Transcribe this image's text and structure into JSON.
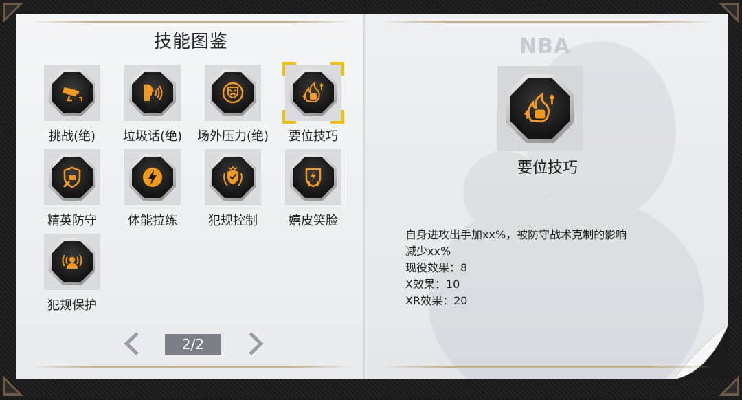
{
  "left_page": {
    "title": "技能图鉴",
    "skills": [
      {
        "label": "挑战(绝)",
        "icon": "camera-icon",
        "selected": false
      },
      {
        "label": "垃圾话(绝)",
        "icon": "trash-talk-icon",
        "selected": false
      },
      {
        "label": "场外压力(绝)",
        "icon": "pressure-mask-icon",
        "selected": false
      },
      {
        "label": "要位技巧",
        "icon": "flame-fist-icon",
        "selected": true
      },
      {
        "label": "精英防守",
        "icon": "shield-wrench-icon",
        "selected": false
      },
      {
        "label": "体能拉练",
        "icon": "lightning-icon",
        "selected": false
      },
      {
        "label": "犯规控制",
        "icon": "laurel-shield-icon",
        "selected": false
      },
      {
        "label": "嬉皮笑脸",
        "icon": "shield-down-icon",
        "selected": false
      },
      {
        "label": "犯规保护",
        "icon": "person-signal-icon",
        "selected": false
      }
    ],
    "pagination": {
      "current_label": "2/2"
    }
  },
  "right_page": {
    "brand": "NBA",
    "skill_name": "要位技巧",
    "skill_icon": "flame-fist-icon",
    "description_lines": [
      "自身进攻出手加xx%，被防守战术克制的影响",
      "减少xx%",
      "现役效果：8",
      "X效果：10",
      "XR效果：20"
    ]
  },
  "colors": {
    "accent_orange": "#f39a1d",
    "selection_yellow": "#f2c200",
    "tile_bg": "#d9dbdf",
    "page_box": "#7b7e84"
  }
}
